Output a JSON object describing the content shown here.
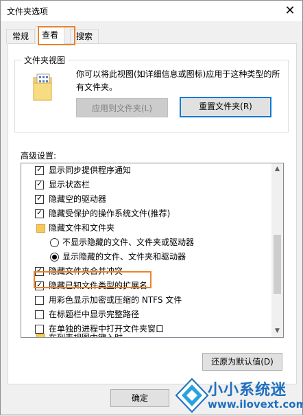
{
  "window": {
    "title": "文件夹选项"
  },
  "tabs": [
    {
      "label": "常规"
    },
    {
      "label": "查看"
    },
    {
      "label": "搜索"
    }
  ],
  "folder_views": {
    "legend": "文件夹视图",
    "description": "你可以将此视图(如详细信息或图标)应用于这种类型的所有文件夹。",
    "apply_button": "应用到文件夹(L)",
    "reset_button": "重置文件夹(R)"
  },
  "advanced": {
    "label": "高级设置:",
    "items": [
      {
        "label": "显示同步提供程序通知",
        "kind": "checkbox",
        "checked": true
      },
      {
        "label": "显示状态栏",
        "kind": "checkbox",
        "checked": true
      },
      {
        "label": "隐藏空的驱动器",
        "kind": "checkbox",
        "checked": true
      },
      {
        "label": "隐藏受保护的操作系统文件(推荐)",
        "kind": "checkbox",
        "checked": true
      },
      {
        "label": "隐藏文件和文件夹",
        "kind": "folder"
      },
      {
        "label": "不显示隐藏的文件、文件夹或驱动器",
        "kind": "radio",
        "checked": false
      },
      {
        "label": "显示隐藏的文件、文件夹和驱动器",
        "kind": "radio",
        "checked": true
      },
      {
        "label": "隐藏文件夹合并冲突",
        "kind": "checkbox",
        "checked": true
      },
      {
        "label": "隐藏已知文件类型的扩展名",
        "kind": "checkbox",
        "checked": true
      },
      {
        "label": "用彩色显示加密或压缩的 NTFS 文件",
        "kind": "checkbox",
        "checked": false
      },
      {
        "label": "在标题栏中显示完整路径",
        "kind": "checkbox",
        "checked": false
      },
      {
        "label": "在单独的进程中打开文件夹窗口",
        "kind": "checkbox",
        "checked": false
      },
      {
        "label": "在列表视图中键入时",
        "kind": "folder"
      }
    ],
    "restore_button": "还原为默认值(D)"
  },
  "footer": {
    "ok_button": "确定"
  },
  "watermark": {
    "title": "小小系统迷",
    "url": "www.ilovext.com"
  },
  "colors": {
    "highlight": "#e8832a",
    "focus": "#0078d7",
    "watermark": "#1e6fbf"
  }
}
